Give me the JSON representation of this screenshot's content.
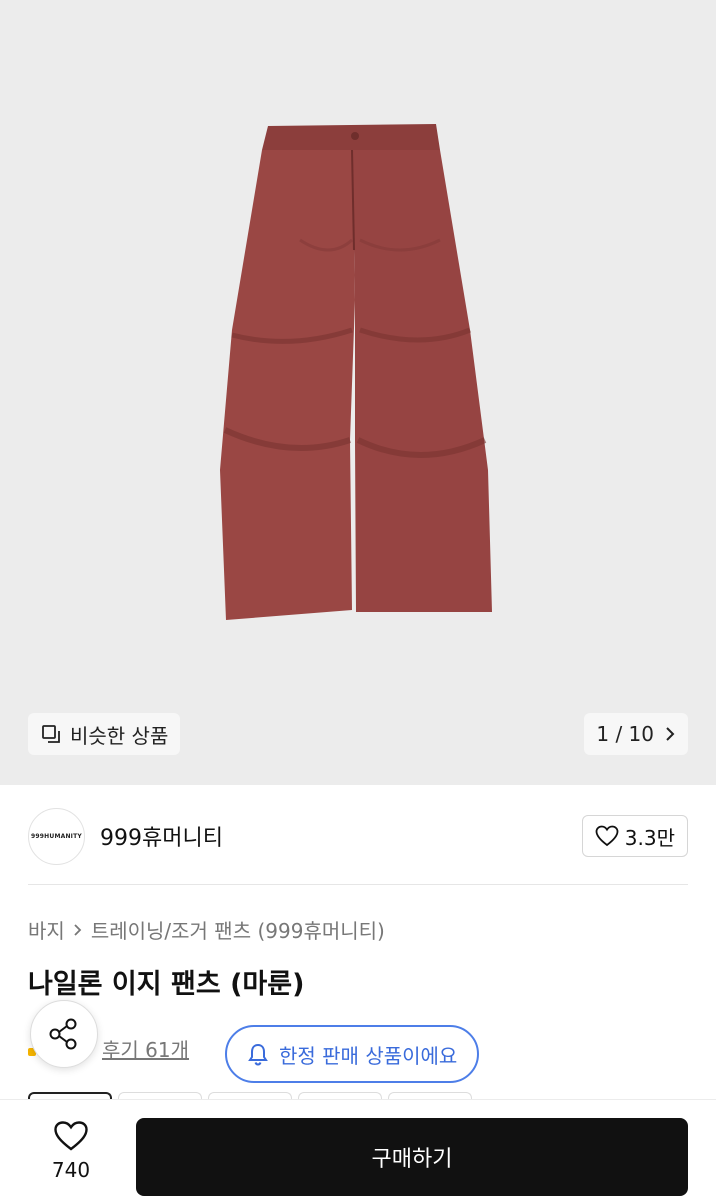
{
  "hero": {
    "similar_label": "비슷한 상품",
    "counter": "1 / 10"
  },
  "shop": {
    "logo_text": "999HUMANITY",
    "name": "999휴머니티",
    "like_count": "3.3만"
  },
  "breadcrumb": {
    "first": "바지",
    "second": "트레이닝/조거 팬츠 (999휴머니티)"
  },
  "product": {
    "title": "나일론 이지 팬츠 (마룬)",
    "reviews": "후기 61개",
    "badge": "한정 판매 상품이에요"
  },
  "bottom": {
    "wish_count": "740",
    "buy_label": "구매하기"
  },
  "colors": {
    "pants": "#9a4744",
    "hero_bg": "#ececec",
    "badge_blue": "#3a6bdb",
    "buy_bg": "#111111"
  },
  "icons": [
    "copy-icon",
    "chevron-right-icon",
    "heart-icon",
    "share-icon",
    "bell-icon",
    "product-image"
  ]
}
